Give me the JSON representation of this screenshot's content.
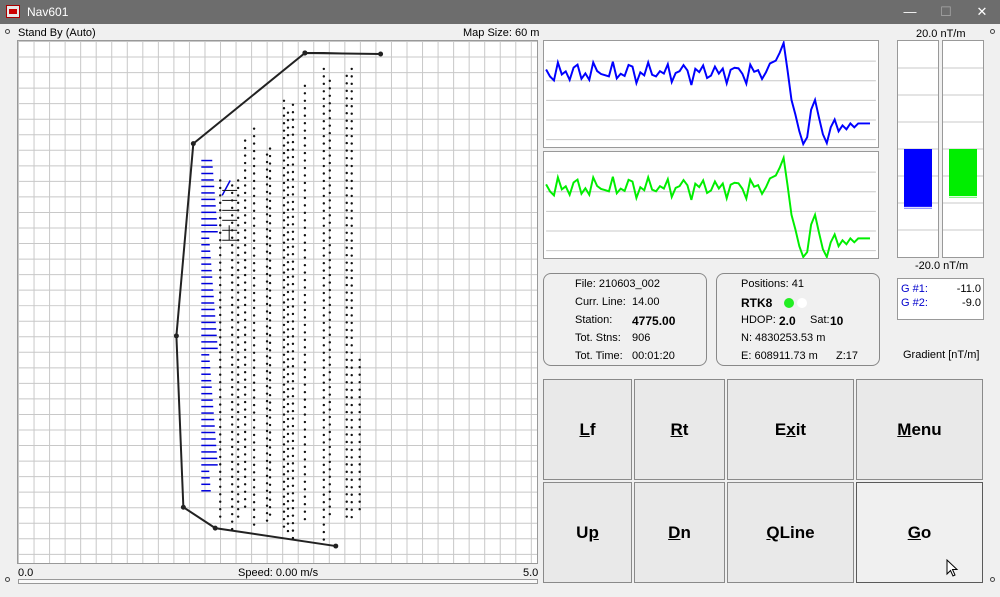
{
  "window": {
    "title": "Nav601",
    "controls": {
      "minimize": "—",
      "maximize": "☐",
      "close": "✕"
    }
  },
  "status": "Stand By (Auto)",
  "map_size": "Map Size:  60 m",
  "speed": "Speed:  0.00 m/s",
  "axis": {
    "min": "0.0",
    "max": "5.0"
  },
  "scale": {
    "top": "20.0 nT/m",
    "bottom": "-20.0 nT/m"
  },
  "gradients": [
    {
      "label": "G #1:",
      "value": "-11.0",
      "color": "#0000ff"
    },
    {
      "label": "G #2:",
      "value": "-9.0",
      "color": "#00ee00"
    }
  ],
  "gradient_label": "Gradient [nT/m]",
  "file_info": {
    "file": "File: 210603_002",
    "curr_line_label": "Curr. Line:",
    "curr_line": "14.00",
    "station_label": "Station:",
    "station": "4775.00",
    "tot_stns_label": "Tot. Stns:",
    "tot_stns": "906",
    "tot_time_label": "Tot. Time:",
    "tot_time": "00:01:20"
  },
  "gps": {
    "positions": "Positions:  41",
    "rtk": "RTK8",
    "hdop_label": "HDOP:",
    "hdop": "2.0",
    "sat_label": "Sat:",
    "sat": "10",
    "north": "N:  4830253.53 m",
    "east": "E:   608911.73 m",
    "zone": "Z:17"
  },
  "buttons": {
    "lf": {
      "ul": "L",
      "rest": "f"
    },
    "rt": {
      "ul": "R",
      "rest": "t"
    },
    "exit": {
      "pre": "E",
      "ul": "x",
      "rest": "it"
    },
    "menu": {
      "ul": "M",
      "rest": "enu"
    },
    "up": {
      "pre": "U",
      "ul": "p",
      "rest": ""
    },
    "dn": {
      "ul": "D",
      "rest": "n"
    },
    "qline": {
      "ul": "Q",
      "rest": "Line"
    },
    "go": {
      "ul": "G",
      "rest": "o"
    }
  },
  "colors": {
    "sensor1": "#0000ff",
    "sensor2": "#00ee00",
    "titlebar": "#6d6d6d"
  }
}
